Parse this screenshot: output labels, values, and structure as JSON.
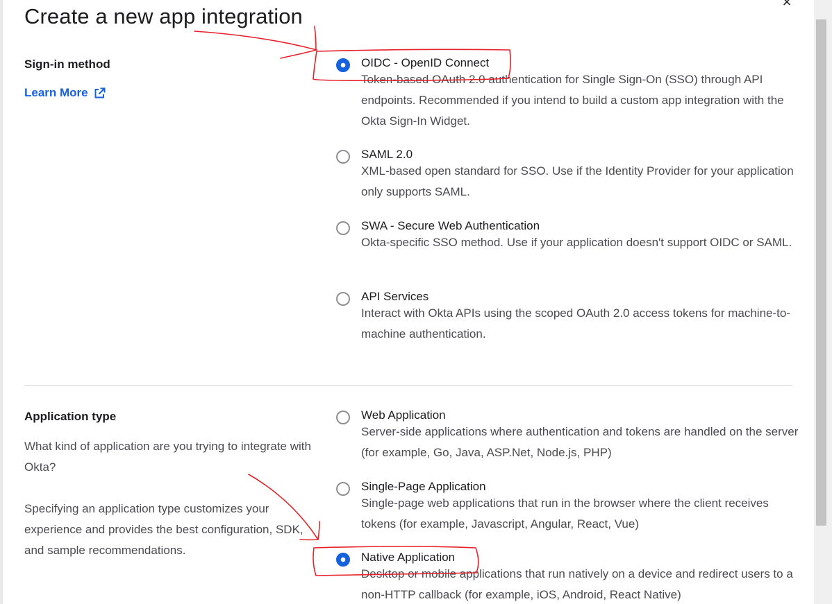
{
  "dialog": {
    "title": "Create a new app integration",
    "close_glyph": "×"
  },
  "sign_in_method": {
    "label": "Sign-in method",
    "learn_more": "Learn More",
    "options": [
      {
        "label": "OIDC - OpenID Connect",
        "selected": true,
        "description": "Token-based OAuth 2.0 authentication for Single Sign-On (SSO) through API endpoints. Recommended if you intend to build a custom app integration with the Okta Sign-In Widget."
      },
      {
        "label": "SAML 2.0",
        "selected": false,
        "description": "XML-based open standard for SSO. Use if the Identity Provider for your application only supports SAML."
      },
      {
        "label": "SWA - Secure Web Authentication",
        "selected": false,
        "description": "Okta-specific SSO method. Use if your application doesn't support OIDC or SAML."
      },
      {
        "label": "API Services",
        "selected": false,
        "description": "Interact with Okta APIs using the scoped OAuth 2.0 access tokens for machine-to-machine authentication."
      }
    ]
  },
  "application_type": {
    "label": "Application type",
    "question": "What kind of application are you trying to integrate with Okta?",
    "hint": "Specifying an application type customizes your experience and provides the best configuration, SDK, and sample recommendations.",
    "options": [
      {
        "label": "Web Application",
        "selected": false,
        "description": "Server-side applications where authentication and tokens are handled on the server (for example, Go, Java, ASP.Net, Node.js, PHP)"
      },
      {
        "label": "Single-Page Application",
        "selected": false,
        "description": "Single-page web applications that run in the browser where the client receives tokens (for example, Javascript, Angular, React, Vue)"
      },
      {
        "label": "Native Application",
        "selected": true,
        "description": "Desktop or mobile applications that run natively on a device and redirect users to a non-HTTP callback (for example, iOS, Android, React Native)"
      }
    ]
  },
  "colors": {
    "accent": "#1662dd",
    "annotation": "#e8202a"
  },
  "icons": {
    "external_link": "external-link-icon",
    "close": "close-icon"
  }
}
